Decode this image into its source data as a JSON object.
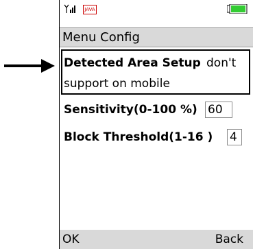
{
  "status_bar": {
    "signal_icon": "signal-bars",
    "java_icon_text": "JAVA",
    "battery_icon": "battery",
    "battery_color": "#33cc33"
  },
  "title": "Menu Config",
  "detected_area": {
    "label": "Detected Area Setup",
    "note_part1": "don't",
    "note_part2": "support on mobile"
  },
  "sensitivity": {
    "label": "Sensitivity(0-100 %)",
    "value": "60"
  },
  "block_threshold": {
    "label": "Block Threshold(1-16 )",
    "value": "4"
  },
  "soft_keys": {
    "left": "OK",
    "right": "Back"
  },
  "annotation_arrow": "right-arrow"
}
